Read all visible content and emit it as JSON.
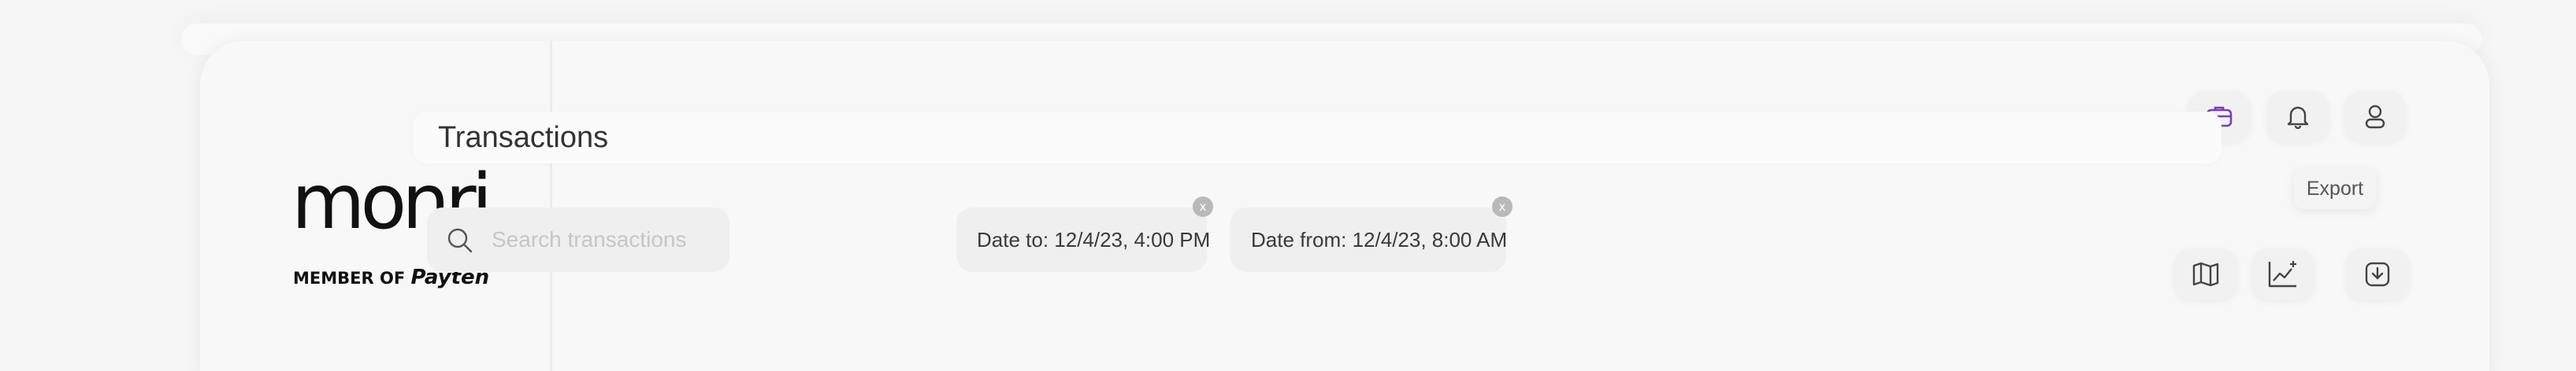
{
  "brand": {
    "logo_word": "monri",
    "logo_member_prefix": "MEMBER OF",
    "logo_member_brand": "Payten"
  },
  "header": {
    "title": "Transactions",
    "icons": [
      "briefcase-icon",
      "bell-icon",
      "user-icon"
    ]
  },
  "toolbar": {
    "search_placeholder": "Search transactions",
    "search_value": "",
    "filters": [
      {
        "label": "Date to: 12/4/23, 4:00 PM",
        "close": "x"
      },
      {
        "label": "Date from: 12/4/23, 8:00 AM",
        "close": "x"
      }
    ],
    "action_icons": [
      "map-icon",
      "chart-add-icon",
      "download-icon"
    ],
    "export_tooltip": "Export"
  },
  "colors": {
    "accent": "#7b3fb0",
    "background": "#f6f6f6",
    "surface": "#efefef",
    "text": "#333333"
  }
}
